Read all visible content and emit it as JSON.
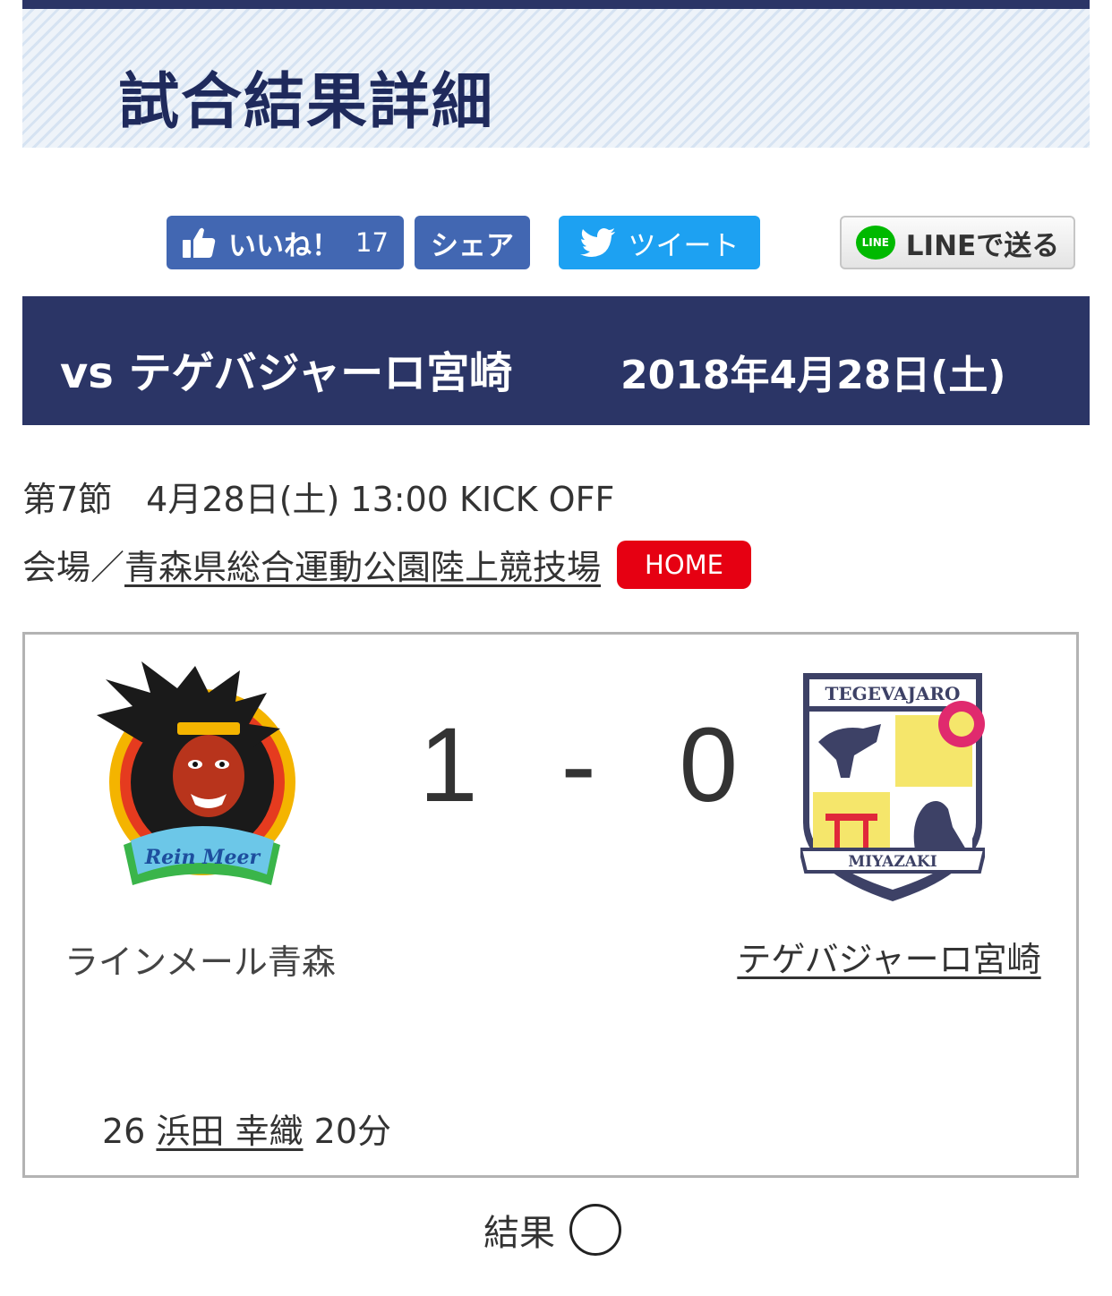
{
  "page_title": "試合結果詳細",
  "share": {
    "like_label": "いいね！",
    "like_count": "17",
    "share_label": "シェア",
    "tweet_label": "ツイート",
    "line_logo_text": "LINE",
    "line_label": "LINEで送る"
  },
  "match": {
    "opponent": "vs テゲバジャーロ宮崎",
    "date": "2018年4月28日(土)",
    "round_info": "第7節　4月28日(土) 13:00 KICK OFF",
    "venue_prefix": "会場／",
    "venue": "青森県総合運動公園陸上競技場",
    "home_badge": "HOME"
  },
  "scoreboard": {
    "home_score": "1",
    "separator": "-",
    "away_score": "0",
    "home_team": "ラインメール青森",
    "away_team": "テゲバジャーロ宮崎",
    "away_logo_top": "TEGEVAJARO",
    "away_logo_bottom": "MIYAZAKI",
    "home_logo_text": "Rein Meer",
    "goals": [
      {
        "number": "26",
        "player": "浜田 幸織",
        "minute": "20分"
      }
    ]
  },
  "result": {
    "label": "結果",
    "mark": "○"
  },
  "colors": {
    "navy": "#2b3566",
    "facebook": "#4267b2",
    "twitter": "#1da1f2",
    "line": "#00b900",
    "home_badge": "#e60012"
  }
}
